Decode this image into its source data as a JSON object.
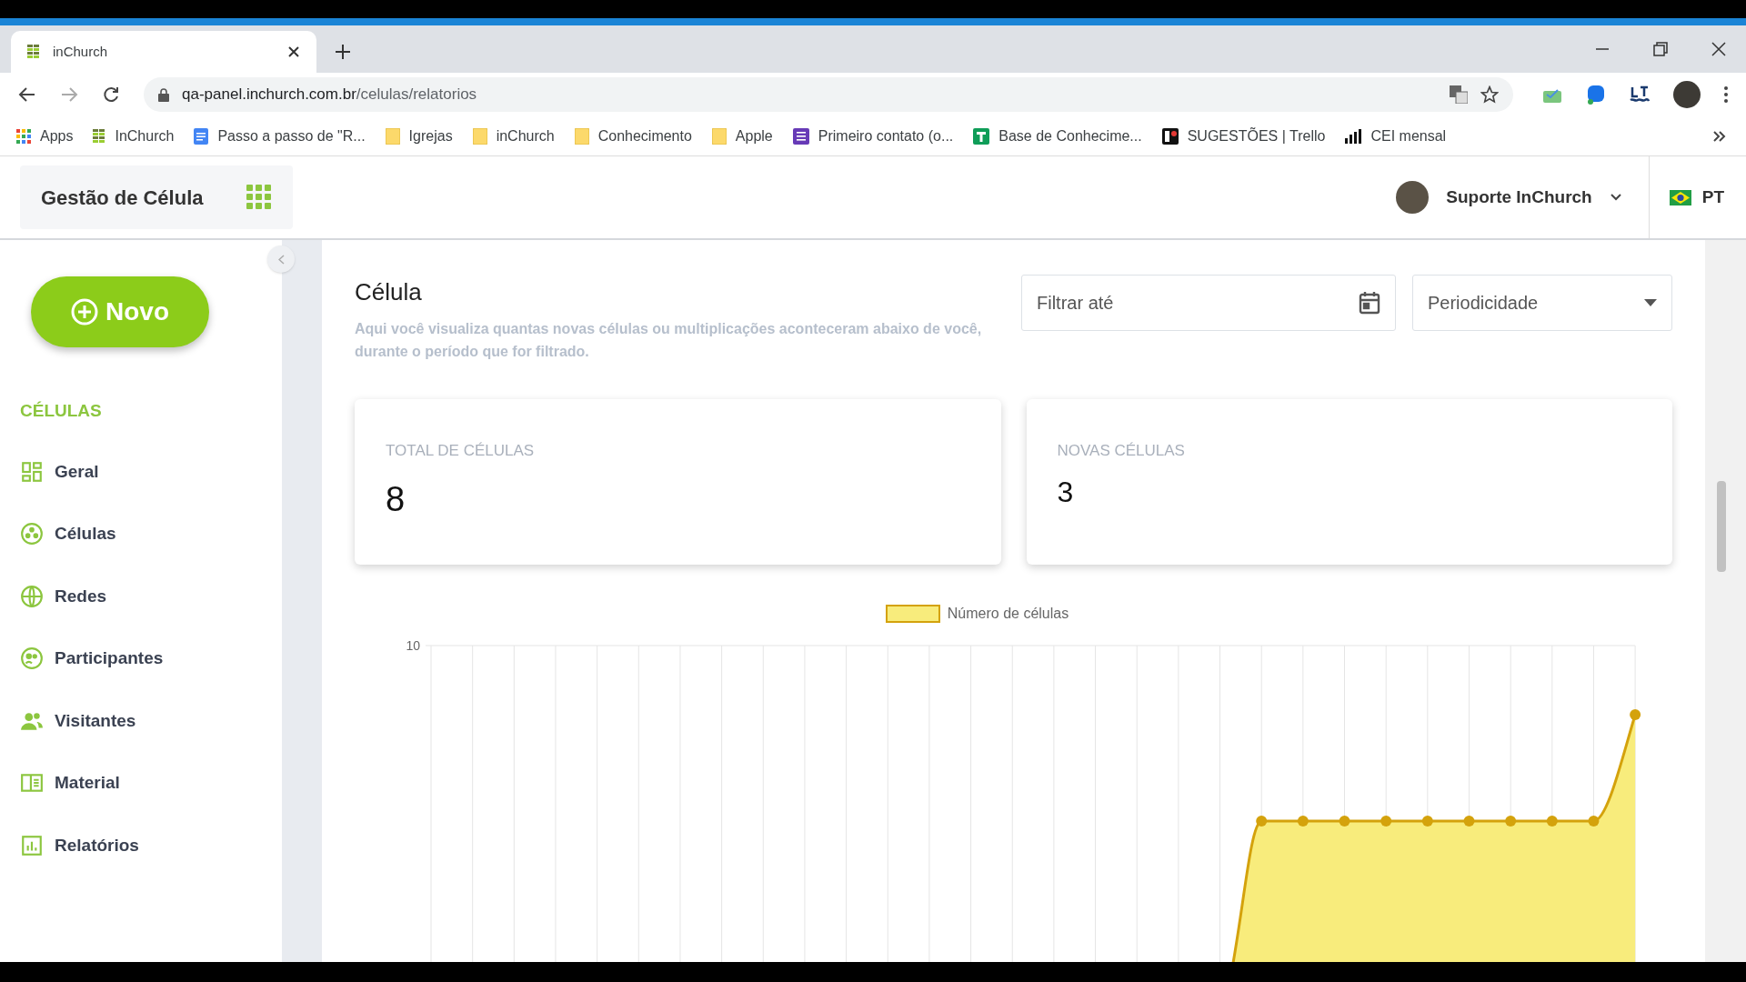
{
  "browser": {
    "tab_title": "inChurch",
    "url_host": "qa-panel.inchurch.com.br",
    "url_path": "/celulas/relatorios",
    "bookmarks": [
      {
        "kind": "apps",
        "label": "Apps"
      },
      {
        "kind": "site",
        "label": "InChurch"
      },
      {
        "kind": "doc",
        "label": "Passo a passo de \"R..."
      },
      {
        "kind": "folder",
        "label": "Igrejas"
      },
      {
        "kind": "folder",
        "label": "inChurch"
      },
      {
        "kind": "folder",
        "label": "Conhecimento"
      },
      {
        "kind": "folder",
        "label": "Apple"
      },
      {
        "kind": "form",
        "label": "Primeiro contato (o..."
      },
      {
        "kind": "sheet",
        "label": "Base de Conhecime..."
      },
      {
        "kind": "trello",
        "label": "SUGESTÕES | Trello"
      },
      {
        "kind": "bars",
        "label": "CEI mensal"
      }
    ]
  },
  "header": {
    "module_title": "Gestão de Célula",
    "user_name": "Suporte InChurch",
    "language": "PT"
  },
  "sidebar": {
    "new_button": "Novo",
    "section_title": "CÉLULAS",
    "items": [
      {
        "kind": "grid",
        "label": "Geral"
      },
      {
        "kind": "cells",
        "label": "Células"
      },
      {
        "kind": "globe",
        "label": "Redes"
      },
      {
        "kind": "face",
        "label": "Participantes"
      },
      {
        "kind": "people",
        "label": "Visitantes"
      },
      {
        "kind": "book",
        "label": "Material"
      },
      {
        "kind": "chart",
        "label": "Relatórios"
      }
    ]
  },
  "page": {
    "title": "Célula",
    "description": "Aqui você visualiza quantas novas células ou multiplicações aconteceram abaixo de você, durante o período que for filtrado.",
    "filter_placeholder": "Filtrar até",
    "period_placeholder": "Periodicidade",
    "stats": [
      {
        "label": "TOTAL DE CÉLULAS",
        "value": "8"
      },
      {
        "label": "NOVAS CÉLULAS",
        "value": "3"
      }
    ],
    "chart": {
      "legend": "Número de células",
      "y_tick": "10"
    }
  }
}
